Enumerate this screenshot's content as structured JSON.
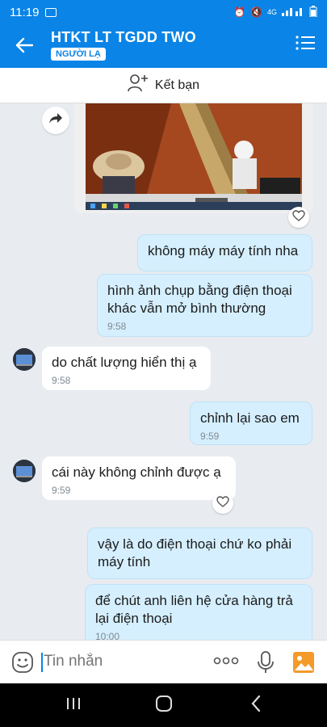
{
  "status": {
    "time": "11:19",
    "network": "4G"
  },
  "header": {
    "title": "HTKT LT TGDD TWO",
    "badge": "NGƯỜI LẠ"
  },
  "add_friend": {
    "label": "Kết bạn"
  },
  "messages": [
    {
      "text": "không máy máy tính nha",
      "time": ""
    },
    {
      "text": "hình ảnh chụp bằng điện thoại khác vẫn mở bình thường",
      "time": "9:58"
    },
    {
      "text": "do chất lượng hiển thị ạ",
      "time": "9:58"
    },
    {
      "text": "chỉnh lại sao em",
      "time": "9:59"
    },
    {
      "text": "cái này không chỉnh được ạ",
      "time": "9:59"
    },
    {
      "text": "vậy là do điện thoại chứ ko phải máy tính",
      "time": ""
    },
    {
      "text": "để chút anh liên hệ cửa hàng trả lại điện thoại",
      "time": "10:00"
    }
  ],
  "input": {
    "placeholder": "Tin nhắn"
  },
  "colors": {
    "accent": "#0a84e6",
    "outgoing_bubble": "#d5efff",
    "incoming_bubble": "#ffffff",
    "chat_bg": "#e8ebf0"
  }
}
